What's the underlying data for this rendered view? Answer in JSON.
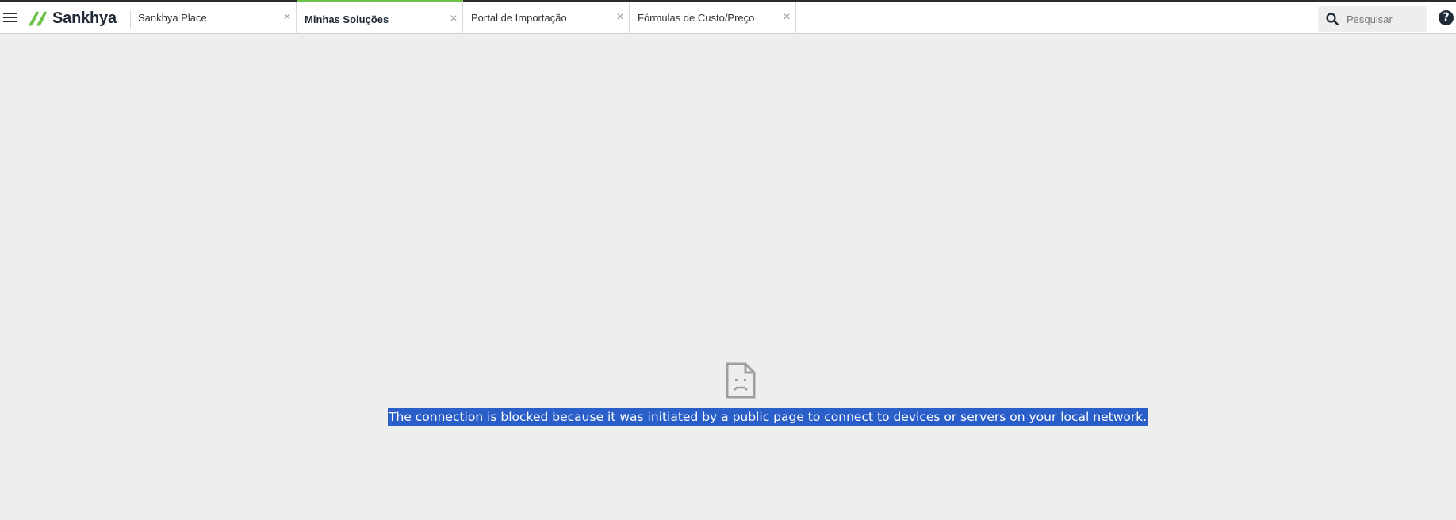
{
  "brand": {
    "name": "Sankhya",
    "color": "#6cc24a"
  },
  "tabs": [
    {
      "label": "Sankhya Place",
      "active": false
    },
    {
      "label": "Minhas Soluções",
      "active": true
    },
    {
      "label": "Portal de Importação",
      "active": false
    },
    {
      "label": "Fórmulas de Custo/Preço",
      "active": false
    }
  ],
  "tab_close_glyph": "×",
  "search": {
    "placeholder": "Pesquisar",
    "value": ""
  },
  "help": {
    "glyph": "?"
  },
  "error": {
    "icon": "sad-document-icon",
    "message": "The connection is blocked because it was initiated by a public page to connect to devices or servers on your local network."
  },
  "colors": {
    "selection": "#2a5fc9",
    "background": "#eeeeee"
  }
}
